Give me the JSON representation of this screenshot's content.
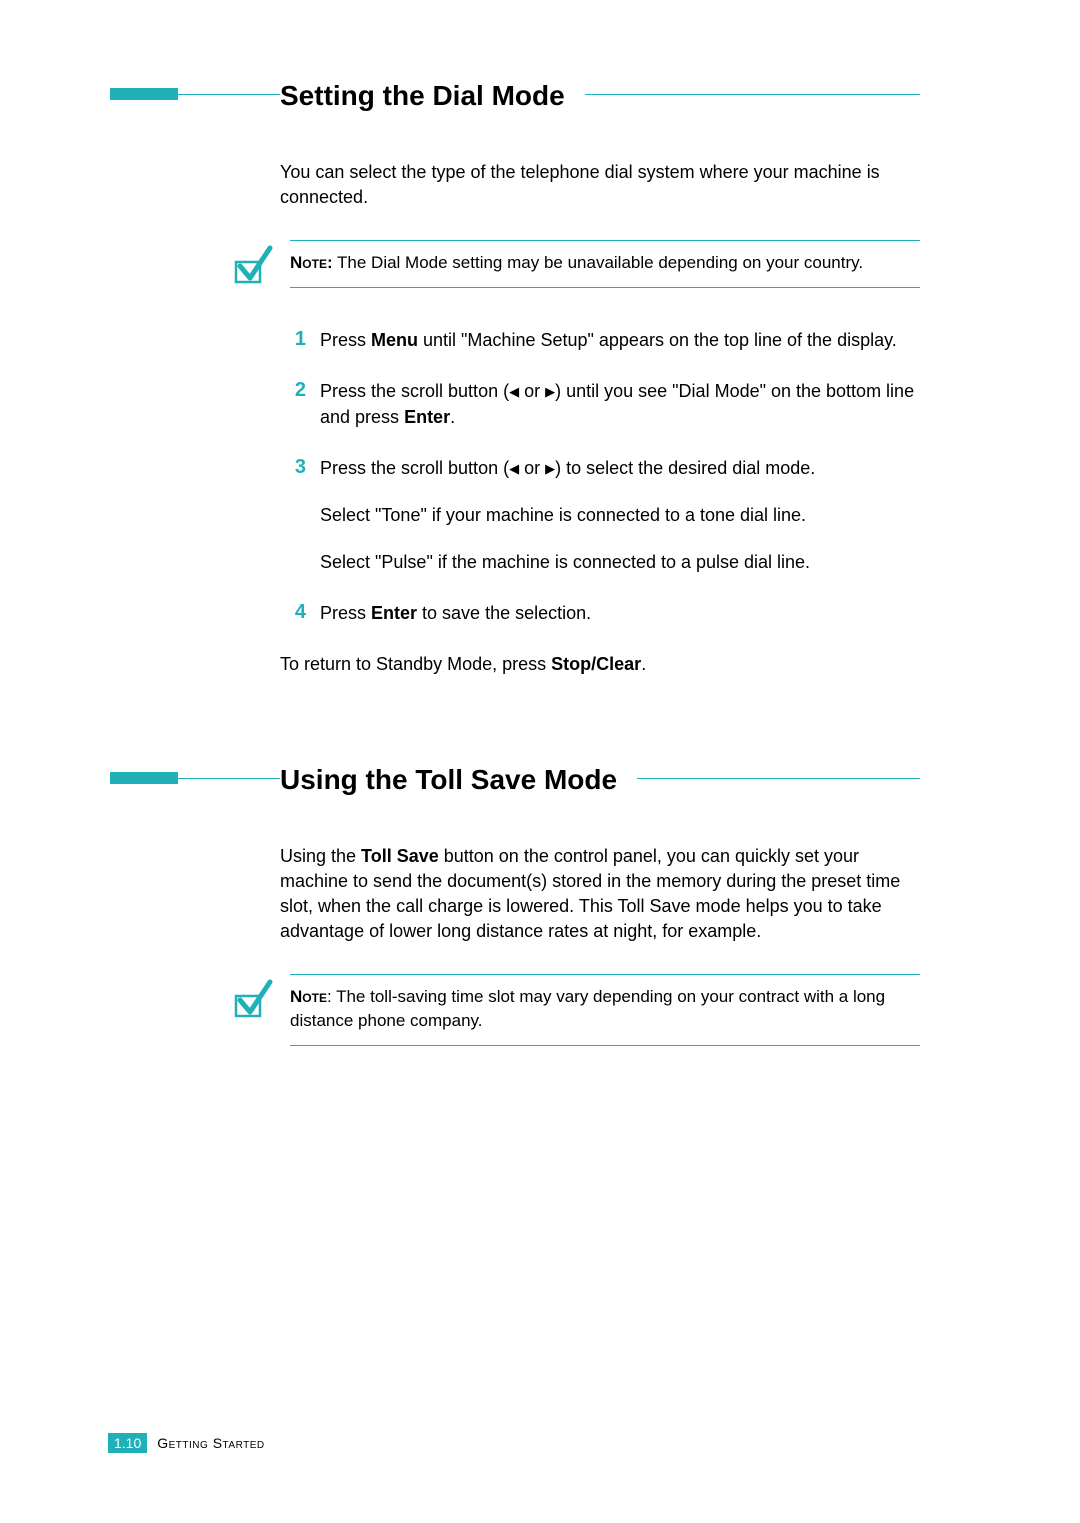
{
  "section1": {
    "title": "Setting the Dial Mode",
    "intro": "You can select the type of the telephone dial system where your machine is connected.",
    "note_label": "Note:",
    "note_text": " The Dial Mode setting may be unavailable depending on your country.",
    "steps": {
      "s1": {
        "num": "1",
        "pre": "Press ",
        "bold1": "Menu",
        "post": " until \"Machine Setup\" appears on the top line of the display."
      },
      "s2": {
        "num": "2",
        "pre": "Press the scroll button (",
        "arrowL": "◀",
        "or": " or ",
        "arrowR": "▶",
        "mid": ") until you see \"Dial Mode\" on the bottom line and press ",
        "bold1": "Enter",
        "post": "."
      },
      "s3": {
        "num": "3",
        "pre": "Press the scroll button (",
        "arrowL": "◀",
        "or": " or ",
        "arrowR": "▶",
        "mid": ") to select the desired dial mode.",
        "p2": "Select \"Tone\" if your machine is connected to a tone dial line.",
        "p3": "Select \"Pulse\" if the machine is connected to a pulse dial line."
      },
      "s4": {
        "num": "4",
        "pre": "Press ",
        "bold1": "Enter",
        "post": " to save the selection."
      }
    },
    "return_pre": "To return to Standby Mode, press ",
    "return_bold": "Stop/Clear",
    "return_post": "."
  },
  "section2": {
    "title": "Using the Toll Save Mode",
    "intro_pre": "Using the ",
    "intro_bold": "Toll Save",
    "intro_post": " button on the control panel, you can quickly set your machine to send the document(s) stored in the memory during the preset time slot, when the call charge is lowered. This Toll Save mode helps you to take advantage of lower long distance rates at night, for example.",
    "note_label": "Note",
    "note_text": ": The toll-saving time slot may vary depending on your contract with a long distance phone company."
  },
  "footer": {
    "page": "1.10",
    "chapter": "Getting Started"
  }
}
